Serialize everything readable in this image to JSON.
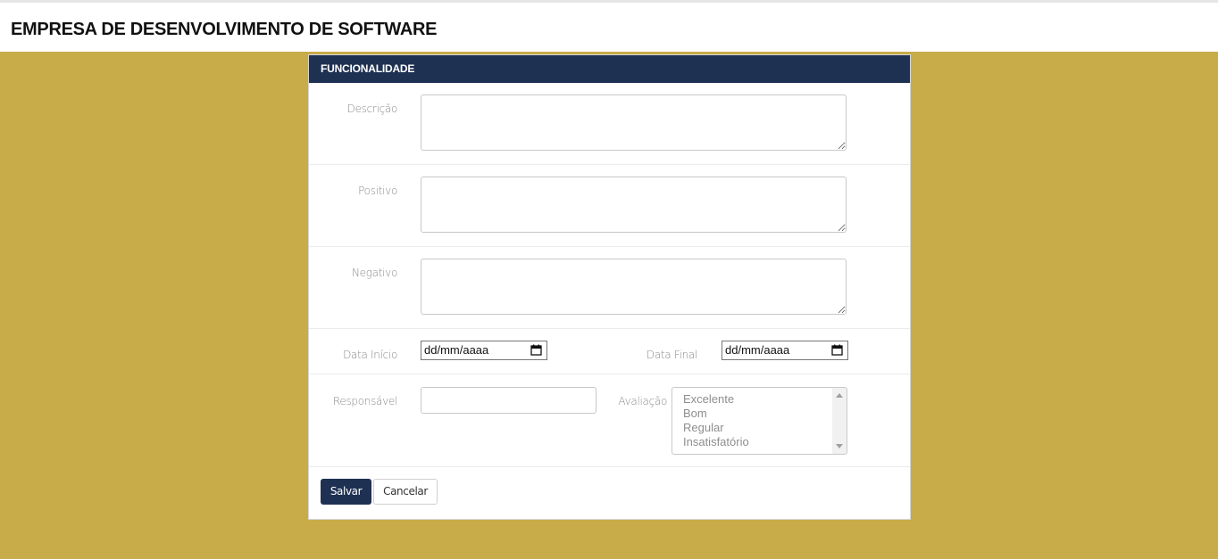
{
  "app": {
    "title": "EMPRESA DE DESENVOLVIMENTO DE SOFTWARE"
  },
  "panel": {
    "header": "FUNCIONALIDADE",
    "fields": {
      "descricao_label": "Descrição",
      "positivo_label": "Positivo",
      "negativo_label": "Negativo",
      "data_inicio_label": "Data Início",
      "data_inicio_value": "dd/mm/aaaa",
      "data_final_label": "Data Final",
      "data_final_value": "dd/mm/aaaa",
      "responsavel_label": "Responsável",
      "avaliacao_label": "Avaliação",
      "avaliacao_options": [
        "Excelente",
        "Bom",
        "Regular",
        "Insatisfatório"
      ]
    },
    "buttons": {
      "save": "Salvar",
      "cancel": "Cancelar"
    }
  },
  "colors": {
    "background": "#c9ac4a",
    "header": "#1f3153"
  },
  "icons": {
    "date": "calendar-icon"
  }
}
